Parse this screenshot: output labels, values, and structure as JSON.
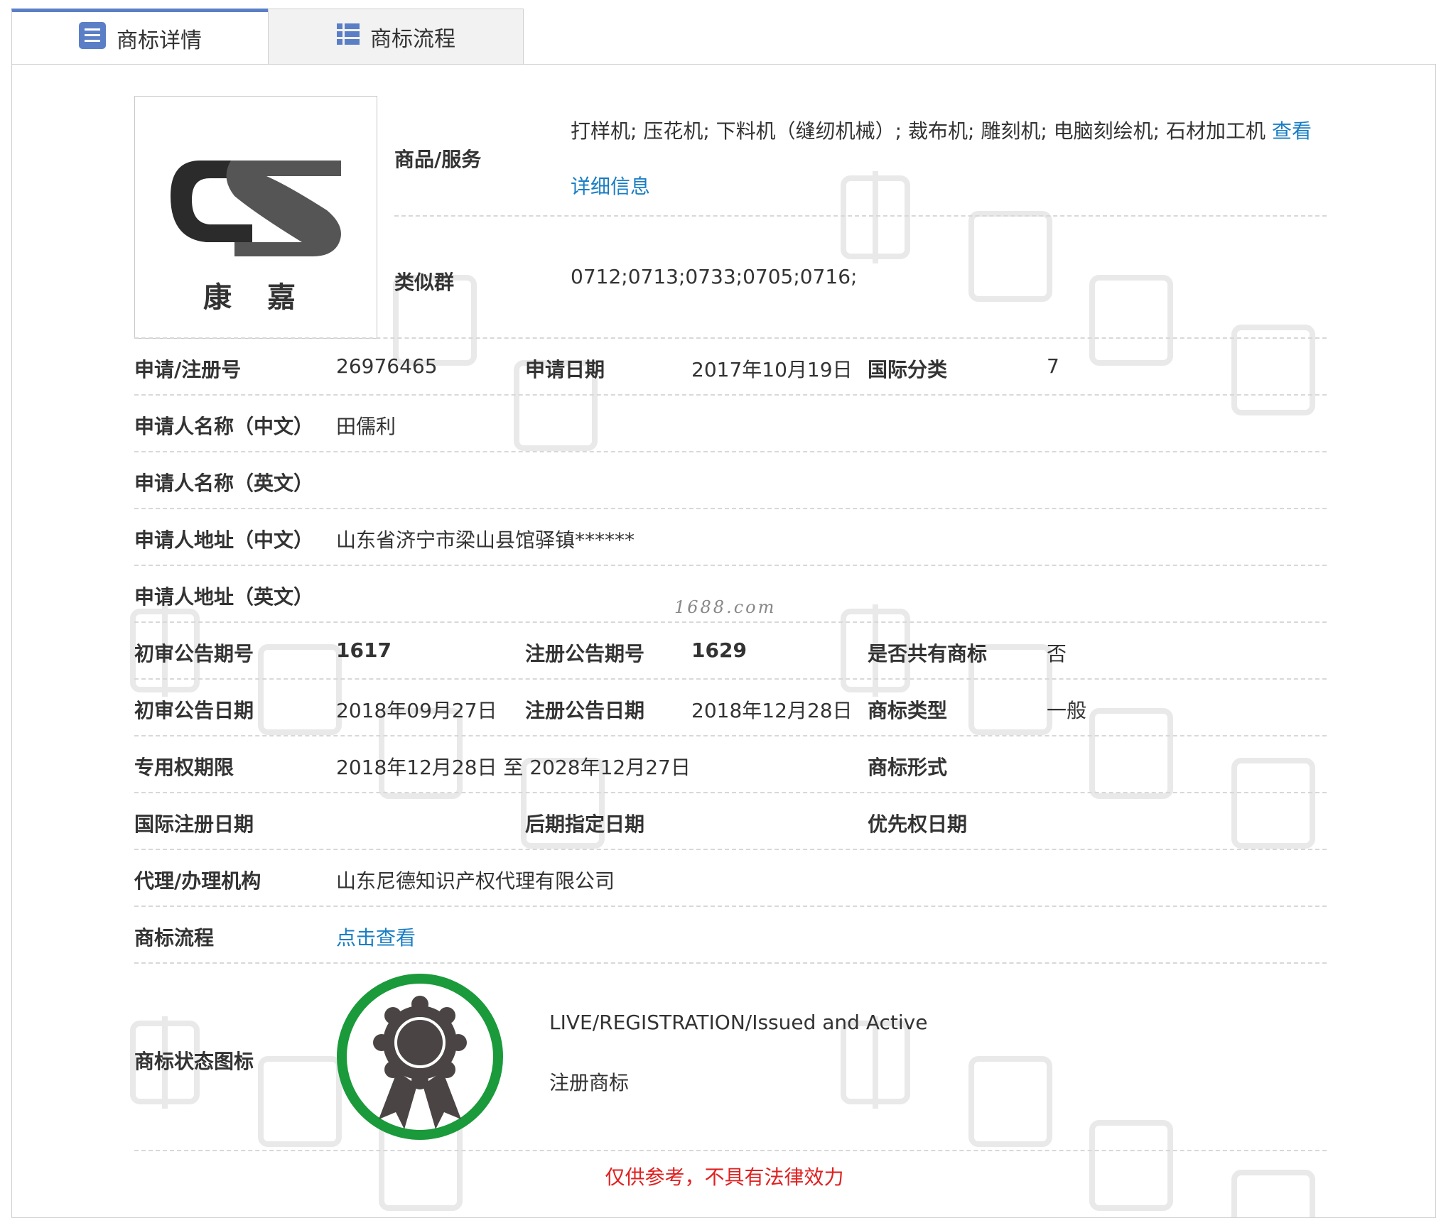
{
  "tabs": [
    {
      "label": "商标详情",
      "icon": "document-list-icon",
      "active": true
    },
    {
      "label": "商标流程",
      "icon": "list-icon",
      "active": false
    }
  ],
  "logo": {
    "mark_text": "康 嘉"
  },
  "goods": {
    "label": "商品/服务",
    "value": "打样机; 压花机; 下料机（缝纫机械）; 裁布机; 雕刻机; 电脑刻绘机; 石材加工机",
    "view_link": "查看",
    "detail_link": "详细信息"
  },
  "similar_group": {
    "label": "类似群",
    "value": "0712;0713;0733;0705;0716;"
  },
  "rows": {
    "reg_no": {
      "label": "申请/注册号",
      "value": "26976465"
    },
    "apply_date": {
      "label": "申请日期",
      "value": "2017年10月19日"
    },
    "intl_class": {
      "label": "国际分类",
      "value": "7"
    },
    "applicant_cn": {
      "label": "申请人名称（中文）",
      "value": "田儒利"
    },
    "applicant_en": {
      "label": "申请人名称（英文）",
      "value": ""
    },
    "address_cn": {
      "label": "申请人地址（中文）",
      "value": "山东省济宁市梁山县馆驿镇******"
    },
    "address_en": {
      "label": "申请人地址（英文）",
      "value": ""
    },
    "prelim_no": {
      "label": "初审公告期号",
      "value": "1617"
    },
    "reg_pub_no": {
      "label": "注册公告期号",
      "value": "1629"
    },
    "shared": {
      "label": "是否共有商标",
      "value": "否"
    },
    "prelim_date": {
      "label": "初审公告日期",
      "value": "2018年09月27日"
    },
    "reg_pub_date": {
      "label": "注册公告日期",
      "value": "2018年12月28日"
    },
    "tm_type": {
      "label": "商标类型",
      "value": "一般"
    },
    "exclusive_period": {
      "label": "专用权期限",
      "value": "2018年12月28日 至 2028年12月27日"
    },
    "tm_form": {
      "label": "商标形式",
      "value": ""
    },
    "intl_reg_date": {
      "label": "国际注册日期",
      "value": ""
    },
    "later_desig_date": {
      "label": "后期指定日期",
      "value": ""
    },
    "priority_date": {
      "label": "优先权日期",
      "value": ""
    },
    "agent": {
      "label": "代理/办理机构",
      "value": "山东尼德知识产权代理有限公司"
    },
    "process": {
      "label": "商标流程",
      "link": "点击查看"
    }
  },
  "status": {
    "label": "商标状态图标",
    "icon": "award-badge-icon",
    "line1": "LIVE/REGISTRATION/Issued and Active",
    "line2": "注册商标"
  },
  "site_watermark": "1688.com",
  "disclaimer": "仅供参考，不具有法律效力",
  "colors": {
    "accent_tab": "#5b7fc6",
    "link": "#1a7ec4",
    "disclaimer": "#e02020",
    "badge_ring": "#1a9a3a",
    "badge_medal": "#4a4544"
  }
}
